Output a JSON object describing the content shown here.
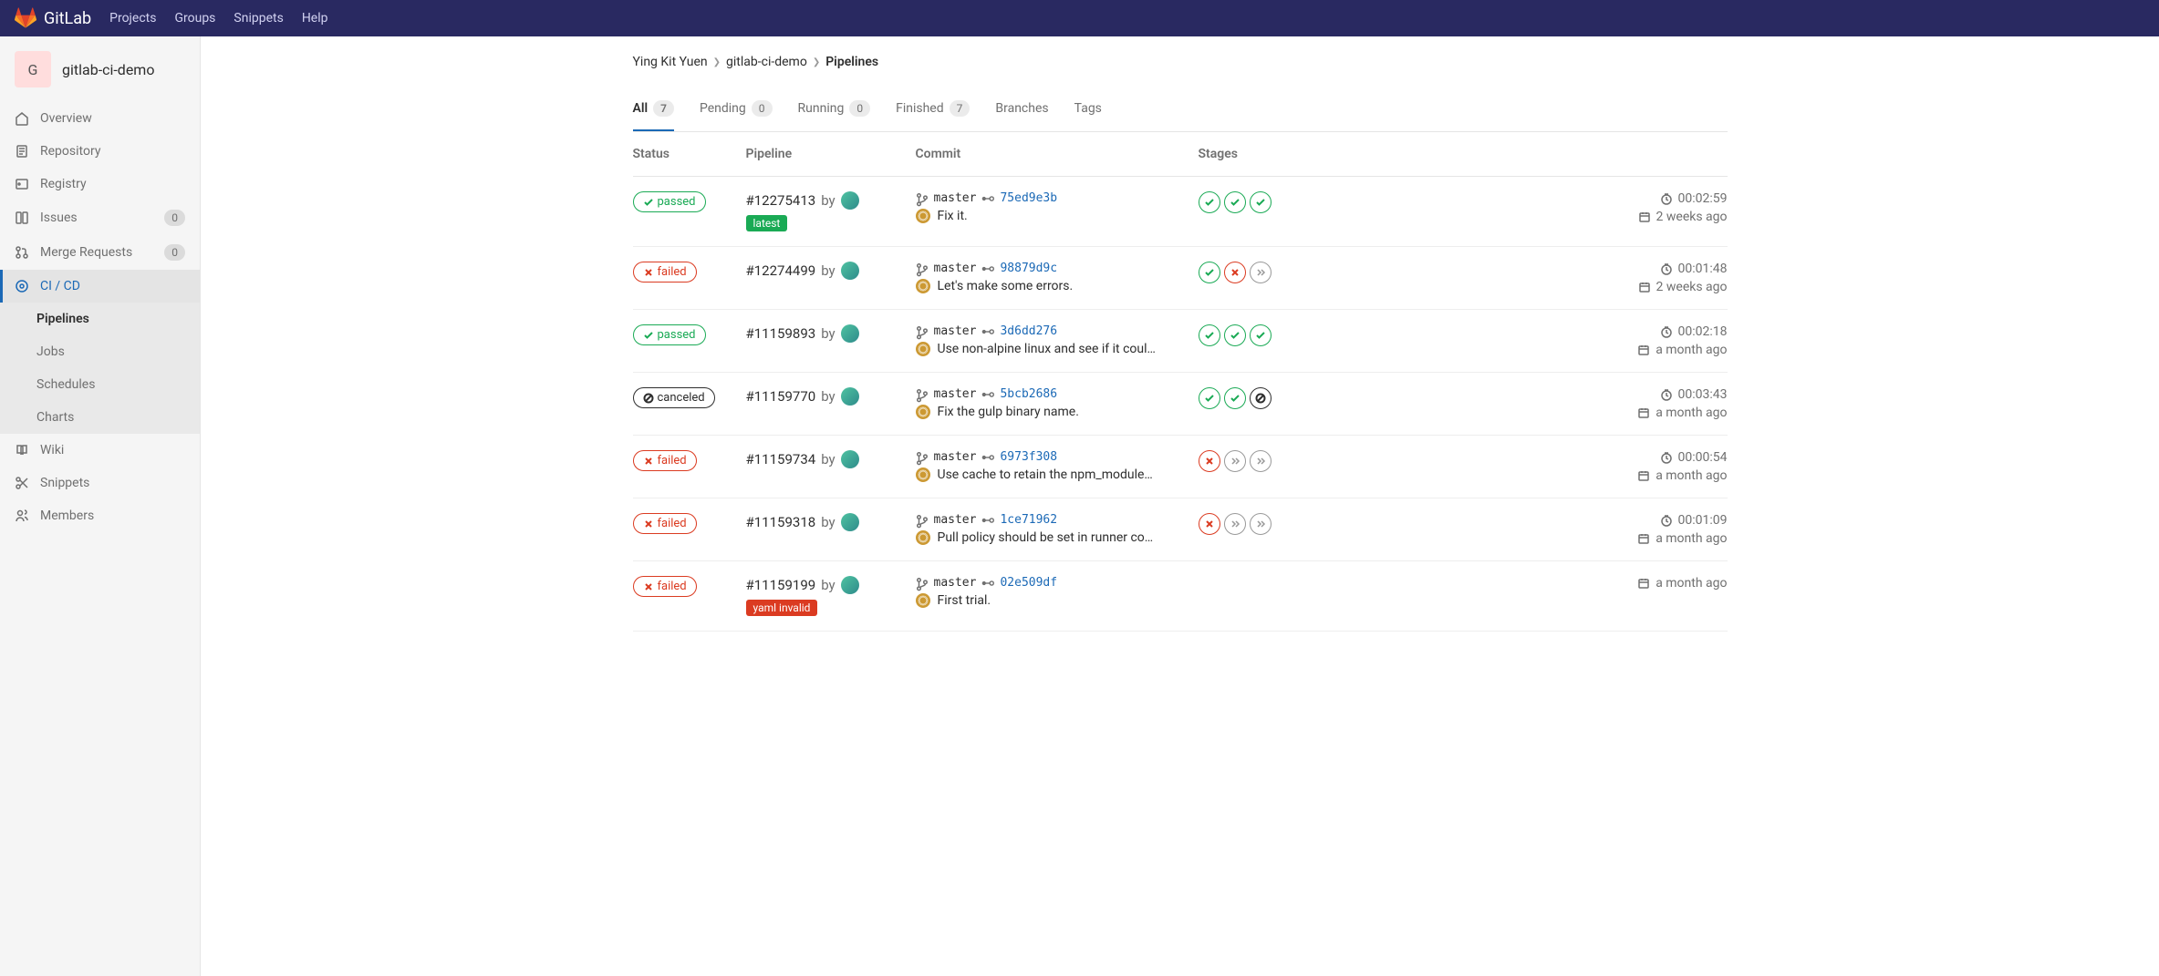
{
  "header": {
    "brand": "GitLab",
    "links": [
      "Projects",
      "Groups",
      "Snippets",
      "Help"
    ]
  },
  "project": {
    "initial": "G",
    "name": "gitlab-ci-demo"
  },
  "sidebar": [
    {
      "label": "Overview",
      "icon": "home"
    },
    {
      "label": "Repository",
      "icon": "doc"
    },
    {
      "label": "Registry",
      "icon": "disk"
    },
    {
      "label": "Issues",
      "icon": "issues",
      "badge": "0"
    },
    {
      "label": "Merge Requests",
      "icon": "mr",
      "badge": "0"
    },
    {
      "label": "CI / CD",
      "icon": "rocket",
      "active": true
    },
    {
      "label": "Wiki",
      "icon": "book"
    },
    {
      "label": "Snippets",
      "icon": "scissors"
    },
    {
      "label": "Members",
      "icon": "users"
    }
  ],
  "subnav": [
    "Pipelines",
    "Jobs",
    "Schedules",
    "Charts"
  ],
  "breadcrumb": [
    "Ying Kit Yuen",
    "gitlab-ci-demo",
    "Pipelines"
  ],
  "tabs": [
    {
      "label": "All",
      "count": "7",
      "active": true
    },
    {
      "label": "Pending",
      "count": "0"
    },
    {
      "label": "Running",
      "count": "0"
    },
    {
      "label": "Finished",
      "count": "7"
    },
    {
      "label": "Branches"
    },
    {
      "label": "Tags"
    }
  ],
  "columns": {
    "status": "Status",
    "pipeline": "Pipeline",
    "commit": "Commit",
    "stages": "Stages"
  },
  "labels": {
    "by": "by",
    "branch": "master"
  },
  "pipelines": [
    {
      "status": "passed",
      "id": "#12275413",
      "tag": "latest",
      "tagClass": "latest",
      "sha": "75ed9e3b",
      "msg": "Fix it.",
      "stages": [
        "pass",
        "pass",
        "pass"
      ],
      "duration": "00:02:59",
      "ago": "2 weeks ago"
    },
    {
      "status": "failed",
      "id": "#12274499",
      "sha": "98879d9c",
      "msg": "Let's make some errors.",
      "stages": [
        "pass",
        "fail",
        "skip"
      ],
      "duration": "00:01:48",
      "ago": "2 weeks ago"
    },
    {
      "status": "passed",
      "id": "#11159893",
      "sha": "3d6dd276",
      "msg": "Use non-alpine linux and see if it could …",
      "stages": [
        "pass",
        "pass",
        "pass"
      ],
      "duration": "00:02:18",
      "ago": "a month ago"
    },
    {
      "status": "canceled",
      "id": "#11159770",
      "sha": "5bcb2686",
      "msg": "Fix the gulp binary name.",
      "stages": [
        "pass",
        "pass",
        "cancel"
      ],
      "duration": "00:03:43",
      "ago": "a month ago"
    },
    {
      "status": "failed",
      "id": "#11159734",
      "sha": "6973f308",
      "msg": "Use cache to retain the npm_modules f…",
      "stages": [
        "fail",
        "skip",
        "skip"
      ],
      "duration": "00:00:54",
      "ago": "a month ago"
    },
    {
      "status": "failed",
      "id": "#11159318",
      "sha": "1ce71962",
      "msg": "Pull policy should be set in runner config.",
      "stages": [
        "fail",
        "skip",
        "skip"
      ],
      "duration": "00:01:09",
      "ago": "a month ago"
    },
    {
      "status": "failed",
      "id": "#11159199",
      "tag": "yaml invalid",
      "tagClass": "yaml",
      "sha": "02e509df",
      "msg": "First trial.",
      "stages": [],
      "ago": "a month ago"
    }
  ]
}
